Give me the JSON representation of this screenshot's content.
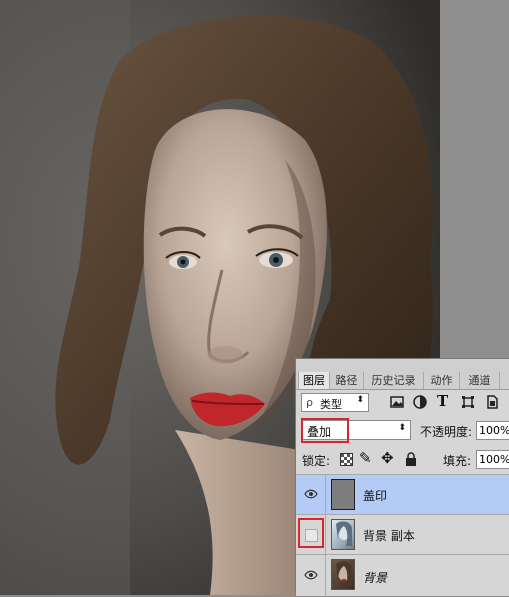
{
  "colors": {
    "panel_bg": "#d6d6d6",
    "selected_layer": "#b4ccf5",
    "highlight_red": "#d8262e"
  },
  "layers_panel": {
    "tabs": [
      "图层",
      "路径",
      "历史记录",
      "动作",
      "通道"
    ],
    "filter": {
      "kind_label": "类型",
      "icon_prefix": "ρ"
    },
    "filter_icons": [
      "image-filter-icon",
      "adjustment-filter-icon",
      "type-filter-icon",
      "shape-filter-icon",
      "smart-object-filter-icon"
    ],
    "blend_mode": "叠加",
    "opacity_label": "不透明度:",
    "opacity_value": "100%",
    "lock_label": "锁定:",
    "fill_label": "填充:",
    "fill_value": "100%",
    "layers": [
      {
        "name": "盖印",
        "visible": true,
        "selected": true
      },
      {
        "name": "背景 副本",
        "visible": false,
        "selected": false
      },
      {
        "name": "背景",
        "visible": true,
        "selected": false
      }
    ]
  }
}
